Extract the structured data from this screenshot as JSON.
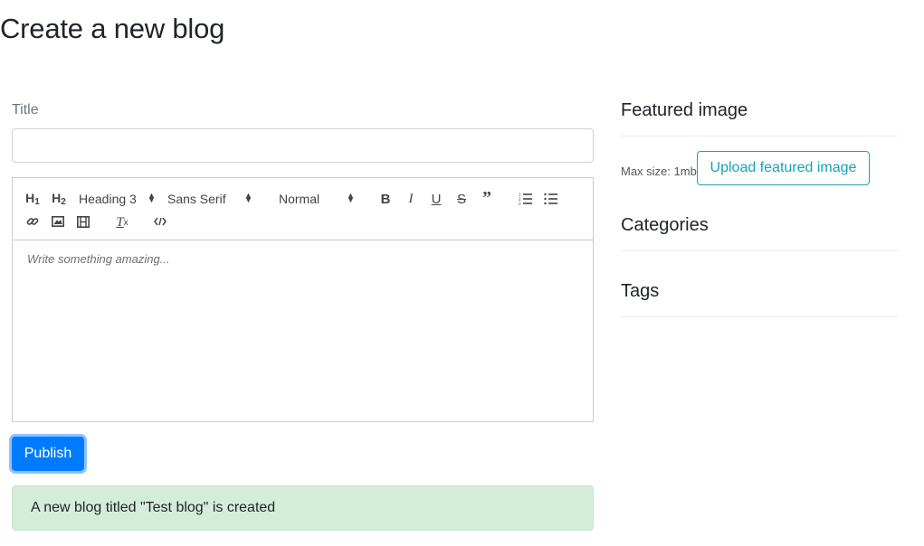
{
  "page": {
    "title": "Create a new blog"
  },
  "form": {
    "title_label": "Title",
    "title_value": "",
    "editor": {
      "toolbar": {
        "h1_label": "H1",
        "h2_label": "H2",
        "header_picker": "Heading 3",
        "font_picker": "Sans Serif",
        "size_picker": "Normal"
      },
      "placeholder": "Write something amazing..."
    },
    "publish_label": "Publish"
  },
  "alert": {
    "message": "A new blog titled \"Test blog\" is created",
    "color": "#d4edda"
  },
  "sidebar": {
    "featured_image": {
      "heading": "Featured image",
      "max_size": "Max size: 1mb",
      "upload_label": "Upload featured image"
    },
    "categories_heading": "Categories",
    "tags_heading": "Tags"
  },
  "colors": {
    "primary": "#007bff",
    "info": "#17a2b8",
    "success_bg": "#d4edda"
  }
}
